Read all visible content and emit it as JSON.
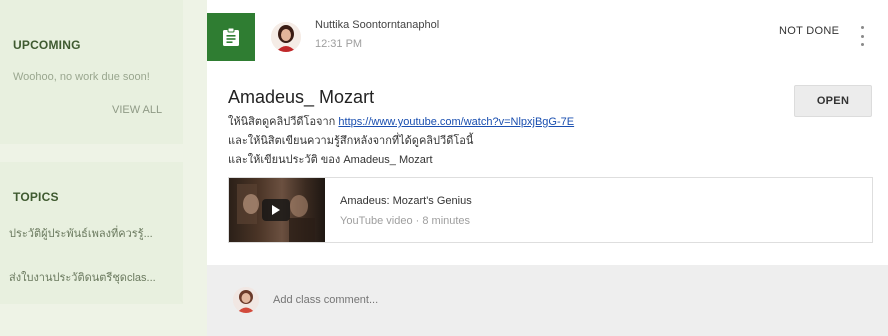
{
  "sidebar": {
    "upcoming": {
      "heading": "UPCOMING",
      "empty_text": "Woohoo, no work due soon!",
      "view_all_label": "VIEW ALL"
    },
    "topics": {
      "heading": "TOPICS",
      "items": [
        {
          "label": "ประวัติผู้ประพันธ์เพลงที่ควรรู้..."
        },
        {
          "label": "ส่งใบงานประวัติดนตรีชุดclas..."
        }
      ]
    }
  },
  "post": {
    "author": "Nuttika Soontorntanaphol",
    "time": "12:31 PM",
    "status": "NOT DONE",
    "title": "Amadeus_ Mozart",
    "lines": {
      "l1_prefix": "ให้นิสิตดูคลิปวีดีโอจาก ",
      "l1_link": "https://www.youtube.com/watch?v=NlpxjBgG-7E",
      "l2": "และให้นิสิตเขียนความรู้สึกหลังจากที่ได้ดูคลิปวีดีโอนี้",
      "l3": "และให้เขียนประวัติ ของ Amadeus_ Mozart"
    },
    "open_label": "OPEN",
    "attachment": {
      "title": "Amadeus: Mozart's Genius",
      "meta": "YouTube video · 8 minutes"
    },
    "comment": {
      "placeholder": "Add class comment..."
    }
  },
  "colors": {
    "badge_green": "#2f7d32",
    "sidebar_bg": "#e8f0df",
    "page_bg": "#eef3e6",
    "link": "#1a4fb0"
  },
  "icons": [
    "assignment-icon",
    "more-vert-icon",
    "play-icon"
  ]
}
